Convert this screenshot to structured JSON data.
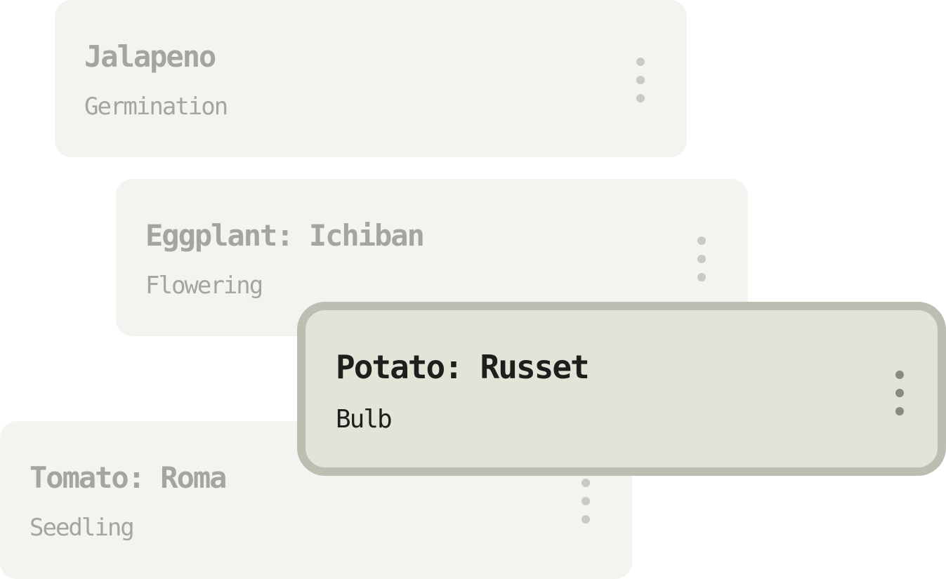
{
  "cards": [
    {
      "title": "Jalapeno",
      "stage": "Germination",
      "state": "inactive"
    },
    {
      "title": "Eggplant: Ichiban",
      "stage": "Flowering",
      "state": "inactive"
    },
    {
      "title": "Potato: Russet",
      "stage": "Bulb",
      "state": "active"
    },
    {
      "title": "Tomato: Roma",
      "stage": "Seedling",
      "state": "inactive"
    }
  ],
  "icons": {
    "menu": "more-vertical-icon"
  },
  "colors": {
    "card_background": "#f3f3ef",
    "card_text_muted": "#a4a4a0",
    "active_card_background": "#e3e3d8",
    "active_card_border": "#bdbdb2",
    "active_card_text": "#1e1e1c"
  }
}
